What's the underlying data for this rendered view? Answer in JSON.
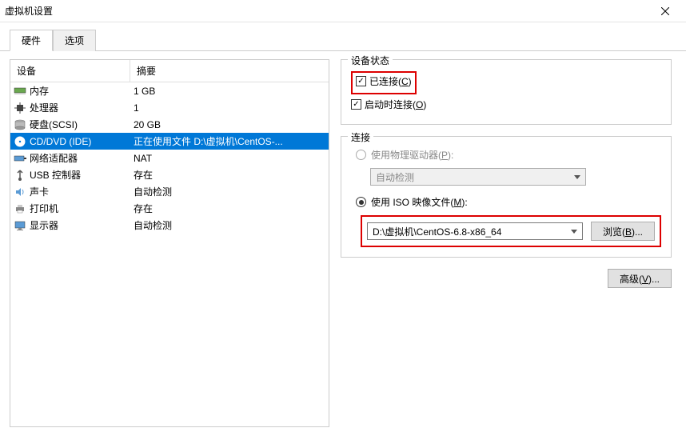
{
  "window": {
    "title": "虚拟机设置"
  },
  "tabs": {
    "hardware": "硬件",
    "options": "选项"
  },
  "headers": {
    "device": "设备",
    "summary": "摘要"
  },
  "devices": [
    {
      "icon": "memory",
      "name": "内存",
      "summary": "1 GB",
      "selected": false
    },
    {
      "icon": "cpu",
      "name": "处理器",
      "summary": "1",
      "selected": false
    },
    {
      "icon": "disk",
      "name": "硬盘(SCSI)",
      "summary": "20 GB",
      "selected": false
    },
    {
      "icon": "cd",
      "name": "CD/DVD (IDE)",
      "summary": "正在使用文件 D:\\虚拟机\\CentOS-...",
      "selected": true
    },
    {
      "icon": "net",
      "name": "网络适配器",
      "summary": "NAT",
      "selected": false
    },
    {
      "icon": "usb",
      "name": "USB 控制器",
      "summary": "存在",
      "selected": false
    },
    {
      "icon": "sound",
      "name": "声卡",
      "summary": "自动检测",
      "selected": false
    },
    {
      "icon": "printer",
      "name": "打印机",
      "summary": "存在",
      "selected": false
    },
    {
      "icon": "display",
      "name": "显示器",
      "summary": "自动检测",
      "selected": false
    }
  ],
  "deviceStatus": {
    "legend": "设备状态",
    "connected": "已连接(C)",
    "connectAtPowerOn": "启动时连接(O)"
  },
  "connection": {
    "legend": "连接",
    "physicalDrive": "使用物理驱动器(P):",
    "autoDetect": "自动检测",
    "isoFile": "使用 ISO 映像文件(M):",
    "isoPath": "D:\\虚拟机\\CentOS-6.8-x86_64",
    "browse": "浏览(B)..."
  },
  "advanced": "高级(V)..."
}
